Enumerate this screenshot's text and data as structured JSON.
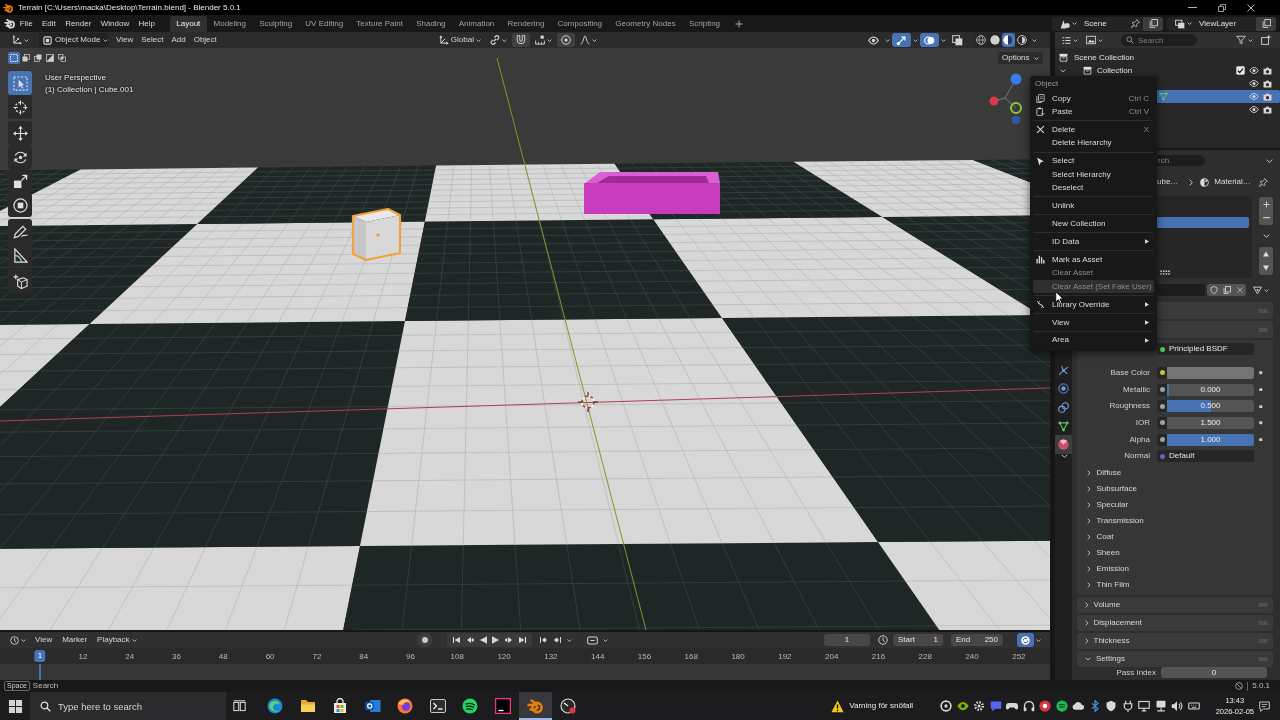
{
  "window": {
    "title": "Terrain [C:\\Users\\macka\\Desktop\\Terrain.blend] - Blender 5.0.1"
  },
  "menu_bar": [
    "File",
    "Edit",
    "Render",
    "Window",
    "Help"
  ],
  "workspaces": [
    {
      "label": "Layout",
      "selected": true
    },
    {
      "label": "Modeling",
      "selected": false
    },
    {
      "label": "Sculpting",
      "selected": false
    },
    {
      "label": "UV Editing",
      "selected": false
    },
    {
      "label": "Texture Paint",
      "selected": false
    },
    {
      "label": "Shading",
      "selected": false
    },
    {
      "label": "Animation",
      "selected": false
    },
    {
      "label": "Rendering",
      "selected": false
    },
    {
      "label": "Compositing",
      "selected": false
    },
    {
      "label": "Geometry Nodes",
      "selected": false
    },
    {
      "label": "Scripting",
      "selected": false
    }
  ],
  "scene": "Scene",
  "view_layer": "ViewLayer",
  "viewport": {
    "mode": "Object Mode",
    "menus": [
      "View",
      "Select",
      "Add",
      "Object"
    ],
    "orientation": "Global",
    "snap_toggles": [
      {
        "on": false
      },
      {
        "on": true
      },
      {
        "on": false
      },
      {
        "on": true
      },
      {
        "on": false
      }
    ],
    "display_toggles": [
      {
        "on": false
      },
      {
        "on": true
      },
      {
        "on": true
      },
      {
        "on": false
      }
    ],
    "shading": [
      {
        "selected": false
      },
      {
        "selected": false
      },
      {
        "selected": true
      },
      {
        "selected": false
      }
    ],
    "select_modes": [
      {
        "selected": true
      },
      {
        "selected": false
      },
      {
        "selected": false
      },
      {
        "selected": false
      },
      {
        "selected": false
      }
    ],
    "options": "Options",
    "info": [
      "User Perspective",
      "(1) Collection | Cube.001"
    ],
    "tools": [
      {
        "selected": true
      },
      {
        "selected": false
      },
      {
        "selected": false
      },
      {
        "selected": false
      },
      {
        "selected": false
      },
      {
        "selected": false
      },
      {
        "selected": false
      },
      {
        "selected": false
      },
      {
        "selected": false
      }
    ],
    "objects": [
      {
        "kind": "cube",
        "selected": true
      },
      {
        "kind": "tray",
        "selected": false
      }
    ]
  },
  "context_menu": {
    "title": "Object",
    "sections": [
      [
        {
          "label": "Copy",
          "shortcut": "Ctrl C",
          "disabled": false,
          "highlighted": false,
          "submenu": false
        },
        {
          "label": "Paste",
          "shortcut": "Ctrl V",
          "disabled": false,
          "highlighted": false,
          "submenu": false
        }
      ],
      [
        {
          "label": "Delete",
          "shortcut": "X",
          "disabled": false,
          "highlighted": false,
          "submenu": false
        },
        {
          "label": "Delete Hierarchy",
          "disabled": false,
          "highlighted": false,
          "submenu": false
        }
      ],
      [
        {
          "label": "Select",
          "disabled": false,
          "highlighted": false,
          "submenu": false
        },
        {
          "label": "Select Hierarchy",
          "disabled": false,
          "highlighted": false,
          "submenu": false
        },
        {
          "label": "Deselect",
          "disabled": false,
          "highlighted": false,
          "submenu": false
        }
      ],
      [
        {
          "label": "Unlink",
          "disabled": false,
          "highlighted": false,
          "submenu": false
        }
      ],
      [
        {
          "label": "New Collection",
          "disabled": false,
          "highlighted": false,
          "submenu": false
        }
      ],
      [
        {
          "label": "ID Data",
          "disabled": false,
          "highlighted": false,
          "submenu": true
        }
      ],
      [
        {
          "label": "Mark as Asset",
          "disabled": false,
          "highlighted": false,
          "submenu": false
        },
        {
          "label": "Clear Asset",
          "disabled": true,
          "highlighted": false,
          "submenu": false
        },
        {
          "label": "Clear Asset (Set Fake User)",
          "disabled": true,
          "highlighted": true,
          "submenu": false
        }
      ],
      [
        {
          "label": "Library Override",
          "disabled": false,
          "highlighted": false,
          "submenu": true
        }
      ],
      [
        {
          "label": "View",
          "disabled": false,
          "highlighted": false,
          "submenu": true
        }
      ],
      [
        {
          "label": "Area",
          "disabled": false,
          "highlighted": false,
          "submenu": true
        }
      ]
    ]
  },
  "outliner": {
    "search": {
      "placeholder": "Search"
    },
    "rows": [
      {
        "kind": "scene",
        "label": "Scene Collection",
        "selected": false
      },
      {
        "kind": "collection",
        "label": "Collection",
        "checked": true,
        "selected": false
      },
      {
        "kind": "object",
        "selected": false
      },
      {
        "kind": "mesh",
        "selected": true
      },
      {
        "kind": "object",
        "selected": false
      }
    ]
  },
  "properties": {
    "tabs": [
      {
        "selected": false
      },
      {
        "selected": false
      },
      {
        "selected": false
      },
      {
        "selected": false
      },
      {
        "selected": true
      }
    ],
    "search": {
      "placeholder": "rch"
    },
    "path": [
      "ube…",
      "Material…"
    ],
    "slots": [
      {
        "selected": true
      }
    ],
    "sockets": [
      {
        "kind": "link",
        "value": "Principled BSDF",
        "color": "#5cc85c"
      },
      {
        "kind": "color",
        "label": "Base Color",
        "swatch": {
          "color": "#747474"
        },
        "color": "#c7c729"
      },
      {
        "kind": "slider",
        "label": "Metallic",
        "value": "0.000",
        "level": 0,
        "color": "#a1a1a1"
      },
      {
        "kind": "slider",
        "label": "Roughness",
        "value": "0.500",
        "level": 0.5,
        "color": "#a1a1a1"
      },
      {
        "kind": "number",
        "label": "IOR",
        "value": "1.500",
        "color": "#a1a1a1"
      },
      {
        "kind": "slider",
        "label": "Alpha",
        "value": "1.000",
        "level": 1,
        "color": "#a1a1a1"
      },
      {
        "kind": "link",
        "label": "Normal",
        "value": "Default",
        "color": "#6363c7"
      }
    ],
    "subpanels": [
      {
        "label": "Diffuse",
        "expanded": false
      },
      {
        "label": "Subsurface",
        "expanded": false
      },
      {
        "label": "Specular",
        "expanded": false
      },
      {
        "label": "Transmission",
        "expanded": false
      },
      {
        "label": "Coat",
        "expanded": false
      },
      {
        "label": "Sheen",
        "expanded": false
      },
      {
        "label": "Emission",
        "expanded": false
      },
      {
        "label": "Thin Film",
        "expanded": false
      }
    ],
    "panels": [
      {
        "label": "Volume",
        "expanded": false
      },
      {
        "label": "Displacement",
        "expanded": false
      },
      {
        "label": "Thickness",
        "expanded": false
      },
      {
        "label": "Settings",
        "expanded": true
      }
    ],
    "settings": [
      {
        "label": "Pass Index",
        "value": "0"
      }
    ]
  },
  "timeline": {
    "menus": [
      "View",
      "Marker",
      "Playback"
    ],
    "frame": "1",
    "start_label": "Start",
    "start": "1",
    "end_label": "End",
    "end": "250",
    "ruler": [
      "12",
      "24",
      "36",
      "48",
      "60",
      "72",
      "84",
      "96",
      "108",
      "120",
      "132",
      "144",
      "156",
      "168",
      "180",
      "192",
      "204",
      "216",
      "228",
      "240",
      "252"
    ],
    "current": "1"
  },
  "status_bar": {
    "key": "Space",
    "hint": "Search",
    "version": "5.0.1"
  },
  "taskbar": {
    "search": {
      "placeholder": "Type here to search"
    },
    "apps": [
      {
        "selected": false
      },
      {
        "selected": false
      },
      {
        "selected": false
      },
      {
        "selected": false
      },
      {
        "selected": false
      },
      {
        "selected": false
      },
      {
        "selected": false
      },
      {
        "selected": false
      },
      {
        "selected": true
      },
      {
        "selected": false
      }
    ],
    "alert": "Varning för snöfall",
    "time": "13:43",
    "date": "2026-02-05"
  }
}
